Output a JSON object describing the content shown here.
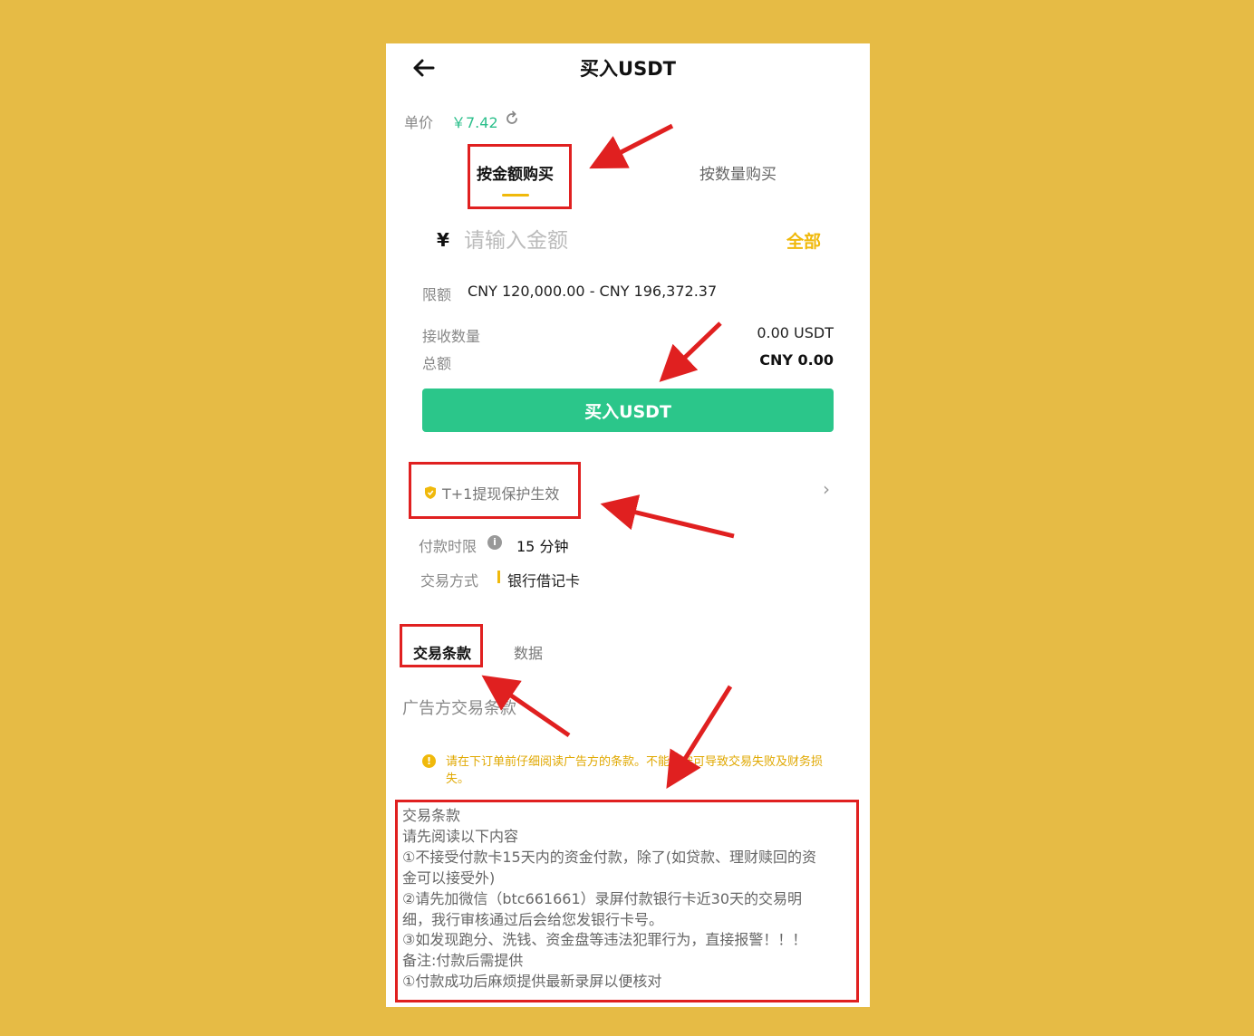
{
  "header": {
    "title": "买入USDT",
    "back_icon": "arrow-left-icon"
  },
  "price": {
    "label": "单价",
    "value": "￥7.42",
    "refresh_icon": "refresh-icon"
  },
  "tabs": {
    "by_amount": "按金额购买",
    "by_quantity": "按数量购买"
  },
  "amount": {
    "currency_symbol": "¥",
    "placeholder": "请输入金额",
    "all_label": "全部"
  },
  "limit": {
    "label": "限额",
    "value": "CNY 120,000.00 - CNY 196,372.37"
  },
  "receive": {
    "label": "接收数量",
    "value": "0.00 USDT"
  },
  "total": {
    "label": "总额",
    "value": "CNY 0.00"
  },
  "buy_button": "买入USDT",
  "protection": {
    "text": "T+1提现保护生效",
    "icon": "shield-icon",
    "chevron": "›"
  },
  "payment_limit": {
    "label": "付款时限",
    "info_icon": "i",
    "value": "15 分钟"
  },
  "trade_method": {
    "label": "交易方式",
    "value": "银行借记卡"
  },
  "bottom_tabs": {
    "terms": "交易条款",
    "data": "数据"
  },
  "advertiser_terms_title": "广告方交易条款",
  "warning": {
    "icon": "!",
    "text": "请在下订单前仔细阅读广告方的条款。不能遵守可导致交易失败及财务损失。"
  },
  "terms_lines": [
    "交易条款",
    "请先阅读以下内容",
    "①不接受付款卡15天内的资金付款，除了(如贷款、理财赎回的资",
    "金可以接受外)",
    "②请先加微信（btc661661）录屏付款银行卡近30天的交易明",
    "细，我行审核通过后会给您发银行卡号。",
    "③如发现跑分、洗钱、资金盘等违法犯罪行为，直接报警！！！",
    "备注:付款后需提供",
    "①付款成功后麻烦提供最新录屏以便核对"
  ],
  "colors": {
    "background": "#E6BB45",
    "accent_green": "#2BC68A",
    "accent_yellow": "#F0B90B",
    "annotation_red": "#E02020"
  }
}
